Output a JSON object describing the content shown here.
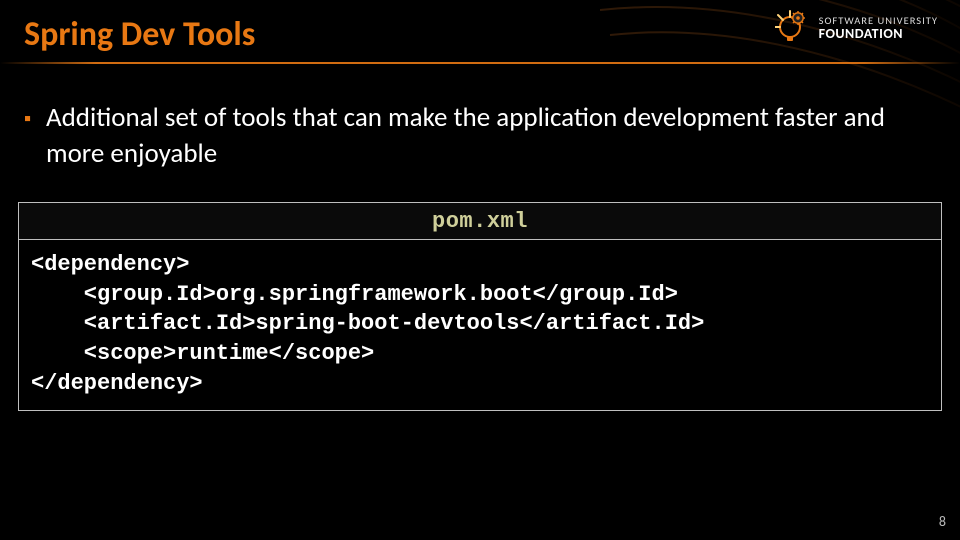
{
  "slide": {
    "title": "Spring Dev Tools",
    "bullet": "Additional set of tools that can make the application development faster and more enjoyable",
    "page_number": "8"
  },
  "logo": {
    "line1": "SOFTWARE UNIVERSITY",
    "line2": "FOUNDATION",
    "icon": "lightbulb-gear-icon"
  },
  "code": {
    "filename": "pom.xml",
    "lines": [
      "<dependency>",
      "    <group.Id>org.springframework.boot</group.Id>",
      "    <artifact.Id>spring-boot-devtools</artifact.Id>",
      "    <scope>runtime</scope>",
      "</dependency>"
    ]
  }
}
